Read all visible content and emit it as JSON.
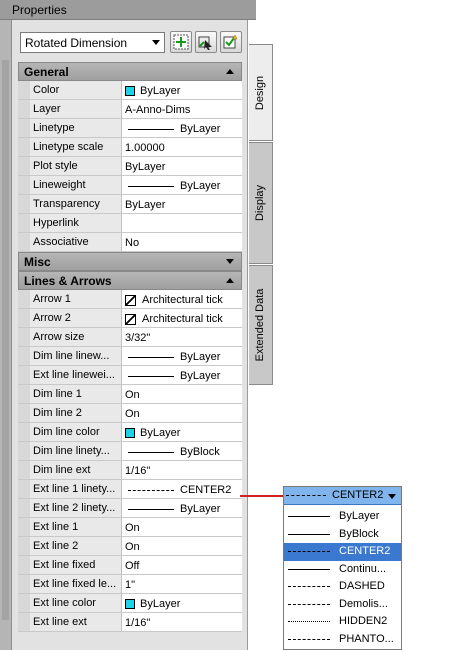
{
  "palette": {
    "title": "Properties",
    "object_type": "Rotated Dimension",
    "toolbar": {
      "toggle_pickadd_icon": "pickadd-toggle-icon",
      "select_objects_icon": "select-objects-icon",
      "quick_select_icon": "quick-select-icon"
    },
    "tabs": [
      "Design",
      "Display",
      "Extended Data"
    ],
    "categories": [
      {
        "name": "General",
        "expanded": true,
        "rows": [
          {
            "name": "Color",
            "value": "ByLayer",
            "kind": "color",
            "color": "#1fd2e6"
          },
          {
            "name": "Layer",
            "value": "A-Anno-Dims",
            "kind": "text"
          },
          {
            "name": "Linetype",
            "value": "ByLayer",
            "kind": "line"
          },
          {
            "name": "Linetype scale",
            "value": "1.00000",
            "kind": "text"
          },
          {
            "name": "Plot style",
            "value": "ByLayer",
            "kind": "text"
          },
          {
            "name": "Lineweight",
            "value": "ByLayer",
            "kind": "line"
          },
          {
            "name": "Transparency",
            "value": "ByLayer",
            "kind": "text"
          },
          {
            "name": "Hyperlink",
            "value": "",
            "kind": "text"
          },
          {
            "name": "Associative",
            "value": "No",
            "kind": "text"
          }
        ]
      },
      {
        "name": "Misc",
        "expanded": false,
        "rows": []
      },
      {
        "name": "Lines & Arrows",
        "expanded": true,
        "rows": [
          {
            "name": "Arrow 1",
            "value": "Architectural tick",
            "kind": "arrow"
          },
          {
            "name": "Arrow 2",
            "value": "Architectural tick",
            "kind": "arrow"
          },
          {
            "name": "Arrow size",
            "value": "3/32\"",
            "kind": "text"
          },
          {
            "name": "Dim line linew...",
            "value": "ByLayer",
            "kind": "line"
          },
          {
            "name": "Ext line linewei...",
            "value": "ByLayer",
            "kind": "line"
          },
          {
            "name": "Dim line 1",
            "value": "On",
            "kind": "text"
          },
          {
            "name": "Dim line 2",
            "value": "On",
            "kind": "text"
          },
          {
            "name": "Dim line color",
            "value": "ByLayer",
            "kind": "color",
            "color": "#1fd2e6"
          },
          {
            "name": "Dim line linety...",
            "value": "ByBlock",
            "kind": "line"
          },
          {
            "name": "Dim line ext",
            "value": "1/16\"",
            "kind": "text"
          },
          {
            "name": "Ext line 1 linety...",
            "value": "CENTER2",
            "kind": "line-dashdot"
          },
          {
            "name": "Ext line 2 linety...",
            "value": "ByLayer",
            "kind": "line"
          },
          {
            "name": "Ext line 1",
            "value": "On",
            "kind": "text"
          },
          {
            "name": "Ext line 2",
            "value": "On",
            "kind": "text"
          },
          {
            "name": "Ext line fixed",
            "value": "Off",
            "kind": "text"
          },
          {
            "name": "Ext line fixed le...",
            "value": "1\"",
            "kind": "text"
          },
          {
            "name": "Ext line color",
            "value": "ByLayer",
            "kind": "color",
            "color": "#1fd2e6"
          },
          {
            "name": "Ext line ext",
            "value": "1/16\"",
            "kind": "text"
          }
        ]
      }
    ]
  },
  "linetype_dropdown": {
    "selected": "CENTER2",
    "options": [
      {
        "label": "ByLayer",
        "style": "solid",
        "selected": false
      },
      {
        "label": "ByBlock",
        "style": "solid",
        "selected": false
      },
      {
        "label": "CENTER2",
        "style": "dashdot",
        "selected": true
      },
      {
        "label": "Continu...",
        "style": "solid",
        "selected": false
      },
      {
        "label": "DASHED",
        "style": "dashed",
        "selected": false
      },
      {
        "label": "Demolis...",
        "style": "demolish",
        "selected": false
      },
      {
        "label": "HIDDEN2",
        "style": "dotted",
        "selected": false
      },
      {
        "label": "PHANTO...",
        "style": "phantom",
        "selected": false
      }
    ]
  },
  "colors": {
    "selection": "#3b79d0",
    "dropdown_header": "#7fb4ec",
    "leader_line": "#d21f1f",
    "bylayer_swatch": "#1fd2e6"
  }
}
